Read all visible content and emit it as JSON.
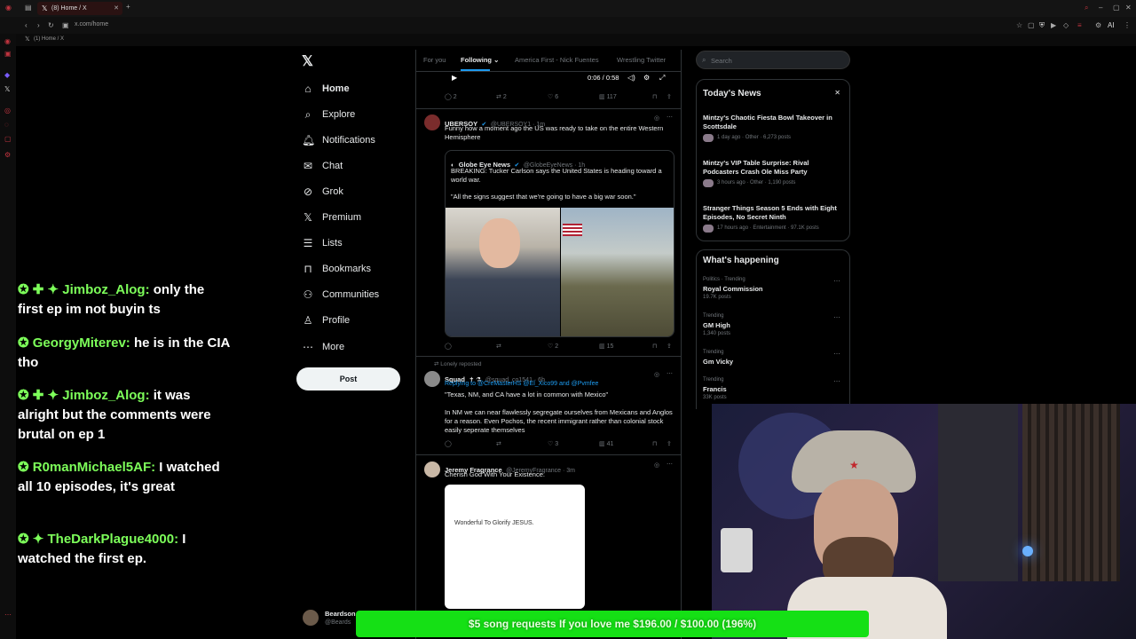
{
  "browser": {
    "tab_title": "(8) Home / X",
    "url": "x.com/home",
    "bookmark": "(1) Home / X",
    "ext_label": "AI"
  },
  "nav": {
    "items": [
      {
        "label": "Home",
        "icon": "home-icon"
      },
      {
        "label": "Explore",
        "icon": "search-icon"
      },
      {
        "label": "Notifications",
        "icon": "bell-icon"
      },
      {
        "label": "Chat",
        "icon": "mail-icon"
      },
      {
        "label": "Grok",
        "icon": "grok-icon"
      },
      {
        "label": "Premium",
        "icon": "x-icon"
      },
      {
        "label": "Lists",
        "icon": "list-icon"
      },
      {
        "label": "Bookmarks",
        "icon": "bookmark-icon"
      },
      {
        "label": "Communities",
        "icon": "people-icon"
      },
      {
        "label": "Profile",
        "icon": "person-icon"
      },
      {
        "label": "More",
        "icon": "more-icon"
      }
    ],
    "post_label": "Post",
    "account_name": "Beardson",
    "account_handle": "@Beards"
  },
  "timeline": {
    "tabs": [
      "For you",
      "Following",
      "America First - Nick Fuentes",
      "Wrestling Twitter"
    ],
    "video_time": "0:06 / 0:58",
    "top_actions": {
      "replies": "2",
      "reposts": "2",
      "likes": "6",
      "views": "117"
    },
    "tweet1": {
      "name": "UBERSOY",
      "handle": "@UBERSOY1 · 1m",
      "text": "Funny how a moment ago the US was ready to take on the entire Western Hemisphere",
      "quote_name": "Globe Eye News",
      "quote_handle": "@GlobeEyeNews · 1h",
      "quote_text": "BREAKING: Tucker Carlson says the United States is heading toward a world war.",
      "quote_text2": "\"All the signs suggest that we're going to have a big war soon.\"",
      "actions": {
        "reposts": "",
        "likes": "2",
        "views": "15"
      }
    },
    "tweet2": {
      "repost_label": "Lonely reposted",
      "name": "Squad",
      "handle": "@squad_co1541 · 6h",
      "reply_to": "Replying to @CreMasterHS @El_Xico99 and @Pvmfee",
      "text": "\"Texas, NM, and CA have a lot in common with Mexico\"",
      "text2": "In NM we can near flawlessly segregate ourselves from Mexicans and Anglos for a reason. Even Pochos, the recent immigrant rather than colonial stock easily seperate themselves",
      "actions": {
        "likes": "3",
        "views": "41"
      }
    },
    "tweet3": {
      "name": "Jeremy Fragrance",
      "handle": "@JeremyFragrance · 3m",
      "text": "Cherish God With Your Existence.",
      "card_text": "Wonderful To Glorify JESUS."
    }
  },
  "right": {
    "search_placeholder": "Search",
    "news_title": "Today's News",
    "news": [
      {
        "title": "Mintzy's Chaotic Fiesta Bowl Takeover in Scottsdale",
        "meta": "1 day ago · Other · 6,273 posts"
      },
      {
        "title": "Mintzy's VIP Table Surprise: Rival Podcasters Crash Ole Miss Party",
        "meta": "3 hours ago · Other · 1,190 posts"
      },
      {
        "title": "Stranger Things Season 5 Ends with Eight Episodes, No Secret Ninth",
        "meta": "17 hours ago · Entertainment · 97.1K posts"
      }
    ],
    "happening_title": "What's happening",
    "trends": [
      {
        "cat": "Politics · Trending",
        "name": "Royal Commission",
        "count": "19.7K posts"
      },
      {
        "cat": "Trending",
        "name": "GM High",
        "count": "1,340 posts"
      },
      {
        "cat": "Trending",
        "name": "Gm Vicky",
        "count": ""
      },
      {
        "cat": "Trending",
        "name": "Francis",
        "count": "33K posts"
      }
    ]
  },
  "chat": [
    {
      "user": "Jimboz_Alog:",
      "badges": "✚ ✦",
      "text": "only the first ep im not buyin ts"
    },
    {
      "user": "GeorgyMiterev:",
      "badges": "",
      "text": "he is in the CIA tho"
    },
    {
      "user": "Jimboz_Alog:",
      "badges": "✚ ✦",
      "text": "it was alright but the comments were brutal on ep 1"
    },
    {
      "user": "R0manMichael5AF:",
      "badges": "",
      "text": "I watched all 10 episodes, it's great"
    },
    {
      "user": "TheDarkPlague4000:",
      "badges": "✦",
      "text": "I watched the first ep."
    }
  ],
  "donation": "$5 song requests If you love me $196.00 / $100.00 (196%)",
  "colors": {
    "accent": "#1d9bf0",
    "chat_user": "#7dff5a",
    "donation_bar": "#15e015"
  }
}
